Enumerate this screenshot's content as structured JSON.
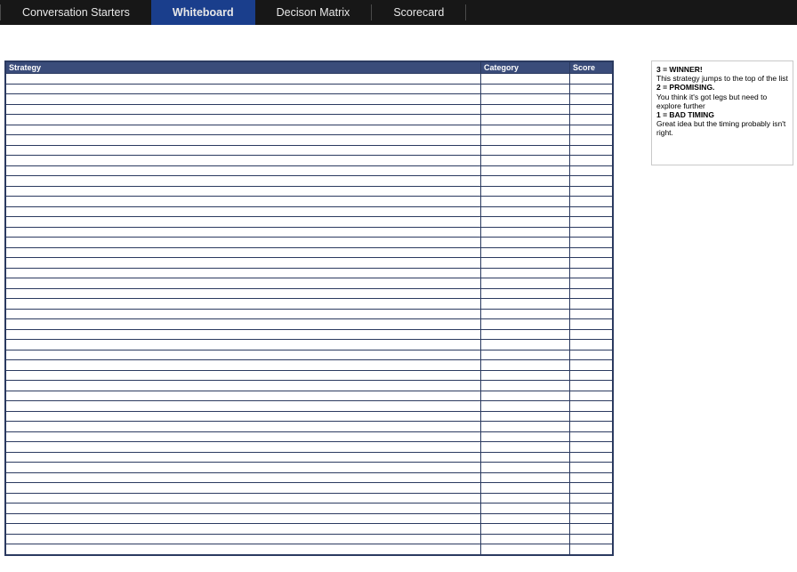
{
  "nav": {
    "tabs": [
      {
        "label": "Conversation Starters",
        "active": false
      },
      {
        "label": "Whiteboard",
        "active": true
      },
      {
        "label": "Decison Matrix",
        "active": false
      },
      {
        "label": "Scorecard",
        "active": false
      }
    ]
  },
  "table": {
    "headers": {
      "strategy": "Strategy",
      "category": "Category",
      "score": "Score"
    },
    "row_count": 47
  },
  "legend": {
    "l1_bold": "3 = WINNER!",
    "l1_text": "This strategy jumps to the top of the list",
    "l2_bold": "2 = PROMISING.",
    "l2_text": "You think it's got legs but need to explore further",
    "l3_bold": "1 = BAD TIMING",
    "l3_text": "Great idea but the timing probably isn't right."
  }
}
